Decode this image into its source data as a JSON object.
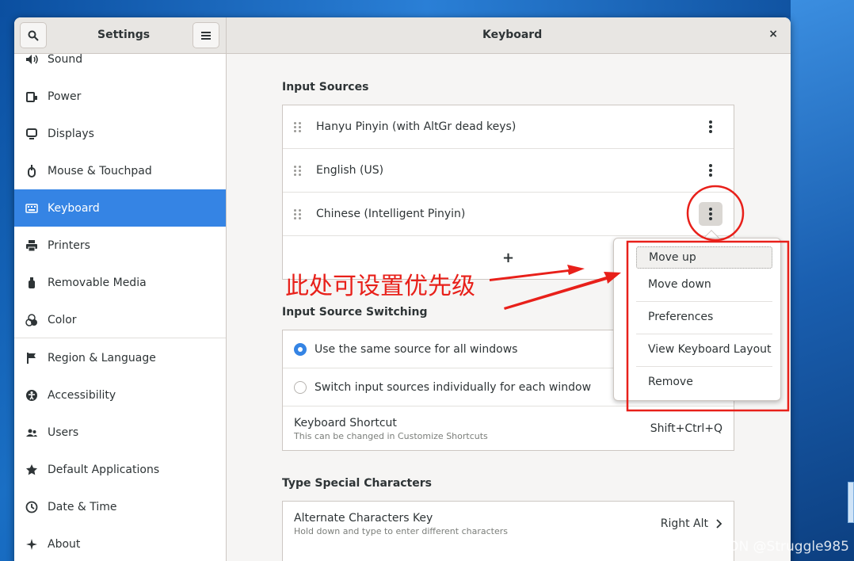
{
  "header": {
    "left_title": "Settings",
    "right_title": "Keyboard",
    "close_label": "×"
  },
  "sidebar": {
    "items": [
      {
        "label": "Sound",
        "icon": "speaker-icon"
      },
      {
        "label": "Power",
        "icon": "power-icon"
      },
      {
        "label": "Displays",
        "icon": "display-icon"
      },
      {
        "label": "Mouse & Touchpad",
        "icon": "mouse-icon"
      },
      {
        "label": "Keyboard",
        "icon": "keyboard-icon",
        "active": true
      },
      {
        "label": "Printers",
        "icon": "printer-icon"
      },
      {
        "label": "Removable Media",
        "icon": "usb-icon"
      },
      {
        "label": "Color",
        "icon": "color-icon"
      },
      {
        "label": "Region & Language",
        "icon": "flag-icon"
      },
      {
        "label": "Accessibility",
        "icon": "accessibility-icon"
      },
      {
        "label": "Users",
        "icon": "users-icon"
      },
      {
        "label": "Default Applications",
        "icon": "star-icon"
      },
      {
        "label": "Date & Time",
        "icon": "clock-icon"
      },
      {
        "label": "About",
        "icon": "sparkle-icon"
      }
    ]
  },
  "input_sources": {
    "title": "Input Sources",
    "sources": [
      "Hanyu Pinyin (with AltGr dead keys)",
      "English (US)",
      "Chinese (Intelligent Pinyin)"
    ],
    "add_label": "+"
  },
  "switching": {
    "title": "Input Source Switching",
    "option_same": "Use the same source for all windows",
    "option_individual": "Switch input sources individually for each window",
    "selected": "same",
    "shortcut_label": "Keyboard Shortcut",
    "shortcut_hint": "This can be changed in Customize Shortcuts",
    "shortcut_value": "Shift+Ctrl+Q"
  },
  "special_chars": {
    "title": "Type Special Characters",
    "alt_key_label": "Alternate Characters Key",
    "alt_key_hint": "Hold down and type to enter different characters",
    "alt_key_value": "Right Alt"
  },
  "popover_menu": {
    "move_up": "Move up",
    "move_down": "Move down",
    "preferences": "Preferences",
    "view_layout": "View Keyboard Layout",
    "remove": "Remove"
  },
  "annotation": {
    "text": "此处可设置优先级",
    "color": "#e8201a"
  },
  "watermark": "CSDN @Struggle985",
  "colors": {
    "accent": "#3584e4"
  }
}
